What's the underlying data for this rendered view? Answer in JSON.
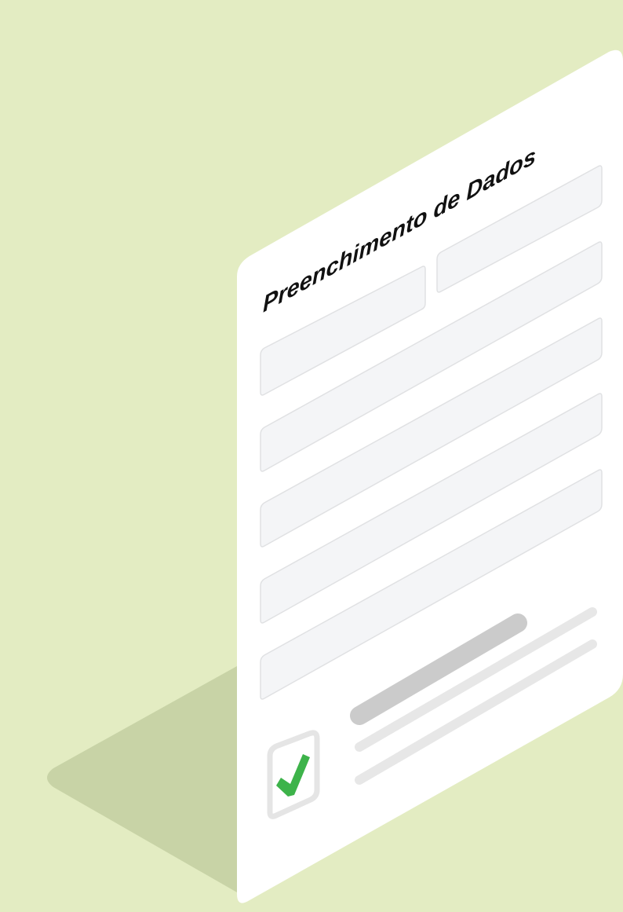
{
  "form": {
    "title": "Preenchimento de Dados",
    "fields": [
      {
        "name": "field-row1-left"
      },
      {
        "name": "field-row1-right"
      },
      {
        "name": "field-row2"
      },
      {
        "name": "field-row3"
      },
      {
        "name": "field-row4"
      },
      {
        "name": "field-row5"
      }
    ],
    "checkbox": {
      "checked": true,
      "icon": "checkmark-icon"
    }
  },
  "colors": {
    "background": "#e3ecc2",
    "shadow": "#c8d3a6",
    "card": "#ffffff",
    "field_fill": "#f4f5f7",
    "field_stroke": "#e0e1e3",
    "text_dark_line": "#cbcbcb",
    "text_light_line": "#e7e7e7",
    "checkbox_border": "#e5e5e5",
    "check": "#3db34a",
    "title": "#111111"
  }
}
